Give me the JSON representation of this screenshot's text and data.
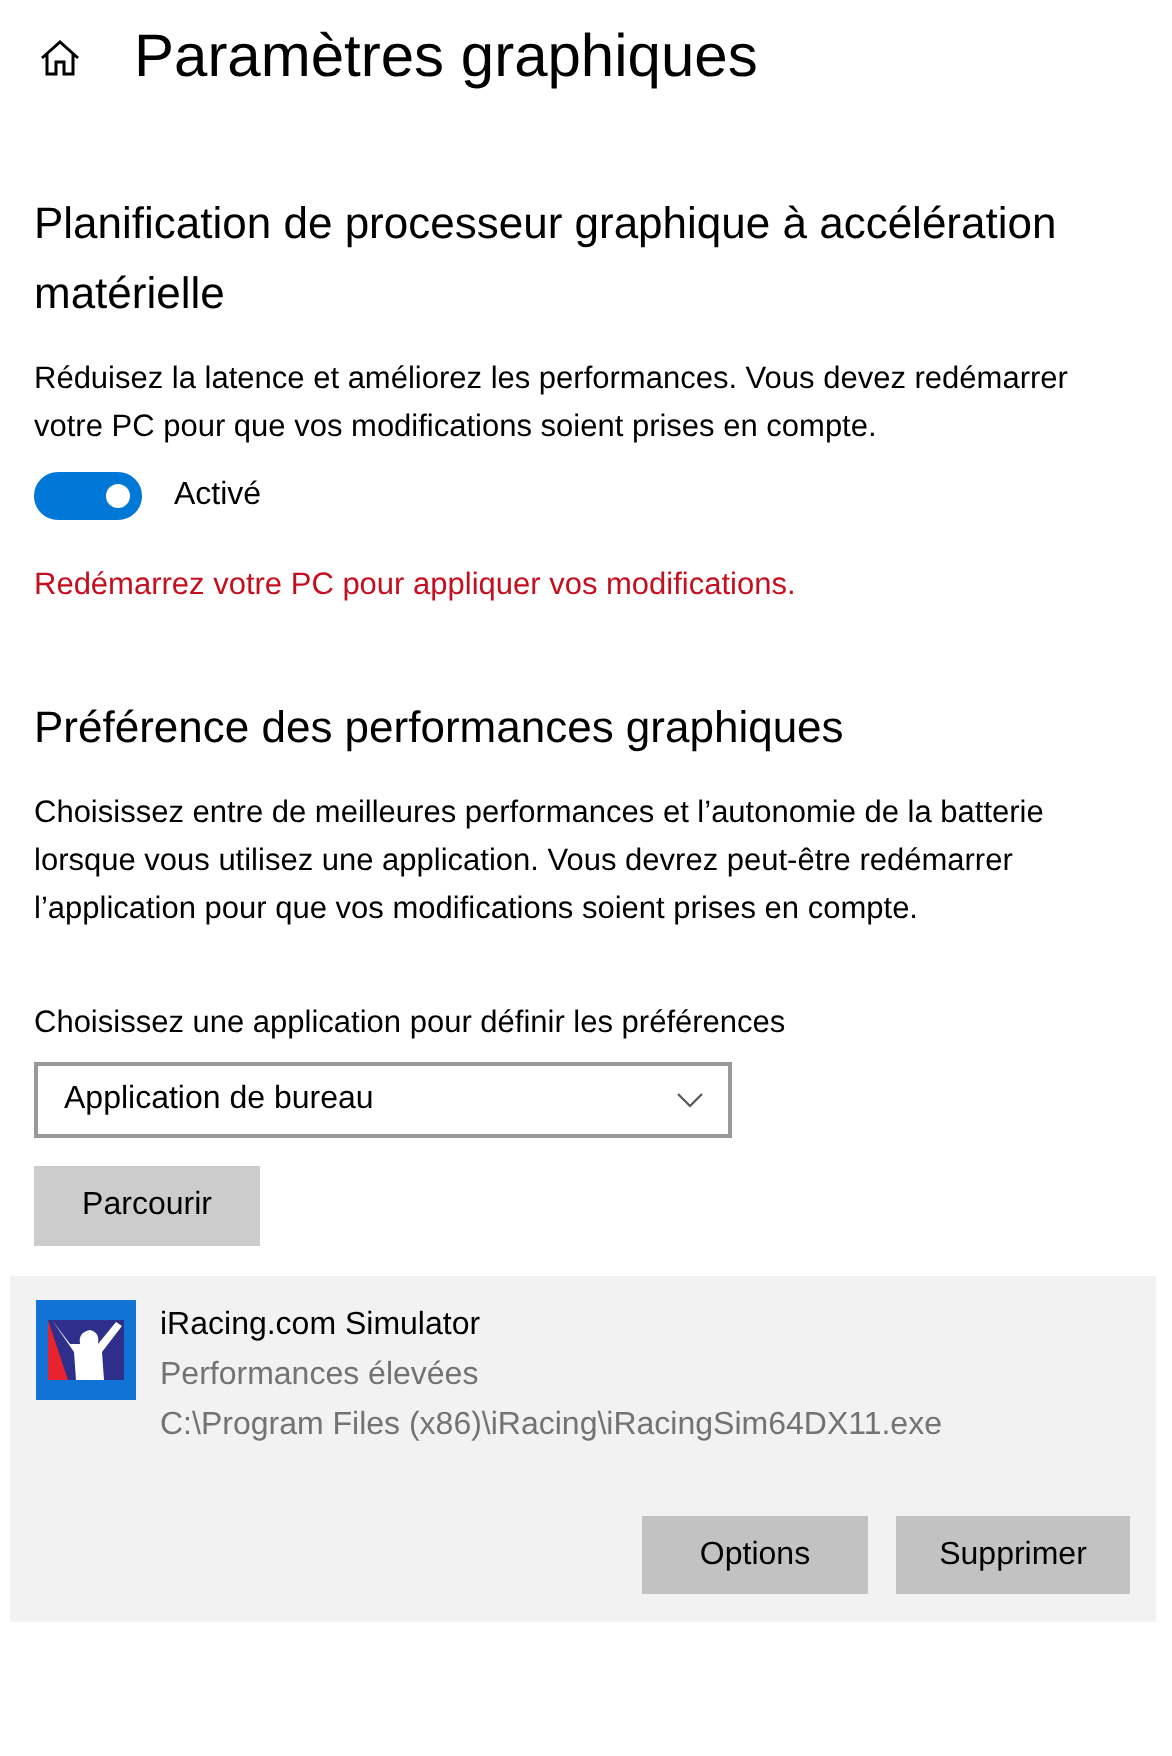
{
  "page": {
    "title": "Paramètres graphiques"
  },
  "scheduling": {
    "heading": "Planification de processeur graphique à accélération matérielle",
    "description": "Réduisez la latence et améliorez les performances. Vous devez redémarrer votre PC pour que vos modifications soient prises en compte.",
    "toggle": {
      "on": true,
      "label": "Activé"
    },
    "warning": "Redémarrez votre PC pour appliquer vos modifications."
  },
  "preference": {
    "heading": "Préférence des performances graphiques",
    "description": "Choisissez entre de meilleures performances et l’autonomie de la batterie lorsque vous utilisez une application. Vous devrez peut-être redémarrer l’application pour que vos modifications soient prises en compte.",
    "select_label": "Choisissez une application pour définir les préférences",
    "select_value": "Application de bureau",
    "browse_button": "Parcourir"
  },
  "apps": [
    {
      "name": "iRacing.com Simulator",
      "preference": "Performances élevées",
      "path": "C:\\Program Files (x86)\\iRacing\\iRacingSim64DX11.exe",
      "selected": true,
      "buttons": [
        "Options",
        "Supprimer"
      ]
    }
  ]
}
